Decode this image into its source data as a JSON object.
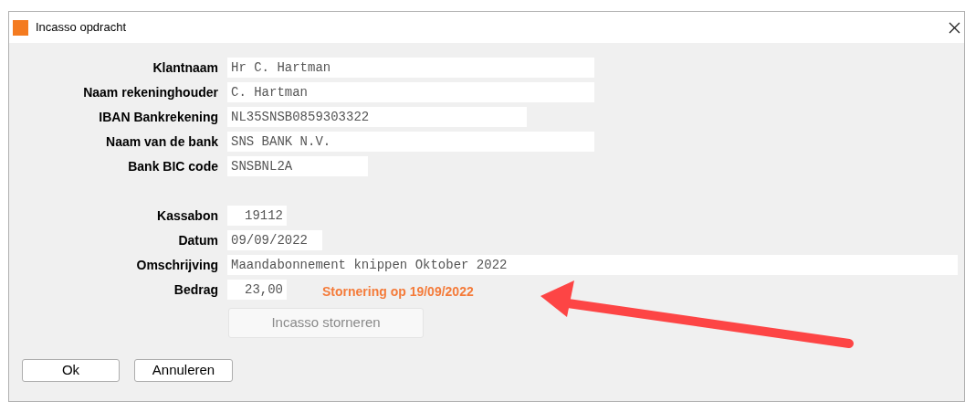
{
  "window": {
    "title": "Incasso opdracht"
  },
  "customer_fields": [
    {
      "label": "Klantnaam",
      "value": "Hr C. Hartman"
    },
    {
      "label": "Naam rekeninghouder",
      "value": "C. Hartman"
    },
    {
      "label": "IBAN Bankrekening",
      "value": "NL35SNSB0859303322"
    },
    {
      "label": "Naam van de bank",
      "value": "SNS BANK N.V."
    },
    {
      "label": "Bank BIC code",
      "value": "SNSBNL2A"
    }
  ],
  "receipt_fields": [
    {
      "label": "Kassabon",
      "value": "19112",
      "kind": "number"
    },
    {
      "label": "Datum",
      "value": "09/09/2022",
      "kind": "text"
    },
    {
      "label": "Omschrijving",
      "value": "Maandabonnement knippen Oktober 2022",
      "kind": "text"
    },
    {
      "label": "Bedrag",
      "value": "23,00",
      "kind": "number"
    }
  ],
  "reversal_notice": "Stornering op 19/09/2022",
  "reverse_button": {
    "label": "Incasso storneren",
    "disabled": true
  },
  "buttons": [
    "Ok",
    "Annuleren"
  ]
}
